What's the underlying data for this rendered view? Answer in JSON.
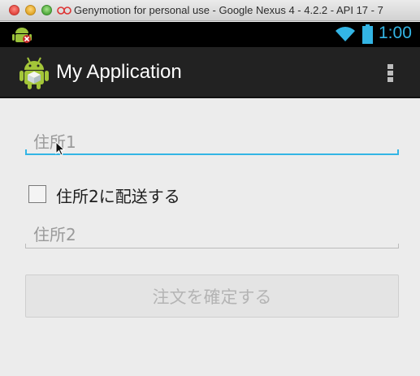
{
  "window": {
    "title": "Genymotion for personal use - Google Nexus 4 - 4.2.2 - API 17 - 7"
  },
  "status_bar": {
    "time": "1:00",
    "accent_color": "#33b5e5"
  },
  "action_bar": {
    "title": "My Application",
    "icons": [
      "android-icon",
      "overflow-menu-icon"
    ]
  },
  "form": {
    "address1": {
      "placeholder": "住所1",
      "value": "",
      "focused": true
    },
    "ship_to_address2": {
      "label": "住所2に配送する",
      "checked": false
    },
    "address2": {
      "placeholder": "住所2",
      "value": ""
    },
    "submit": {
      "label": "注文を確定する",
      "enabled": false
    }
  }
}
